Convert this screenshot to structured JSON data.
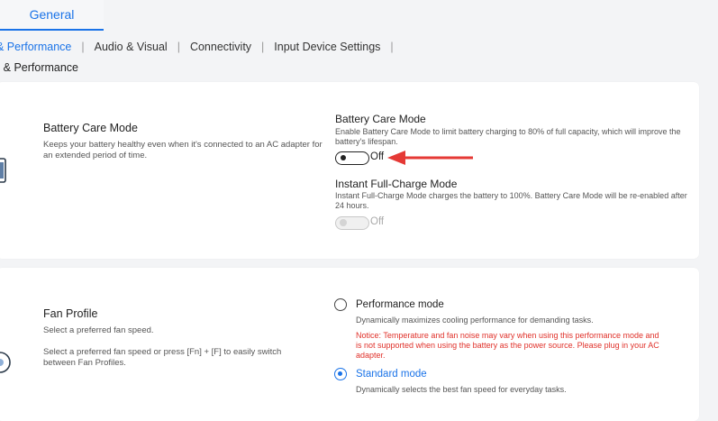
{
  "top_tab": {
    "label": "General"
  },
  "subnav": {
    "items": [
      "& Performance",
      "Audio & Visual",
      "Connectivity",
      "Input Device Settings"
    ],
    "separator": "|"
  },
  "section_title": "r & Performance",
  "battery_card": {
    "left_title": "Battery Care Mode",
    "left_desc": "Keeps your battery healthy even when it's connected to an AC adapter for an extended period of time.",
    "care_title": "Battery Care Mode",
    "care_desc": "Enable Battery Care Mode to limit battery charging to 80% of full capacity, which will improve the battery's lifespan.",
    "care_state": "Off",
    "instant_title": "Instant Full-Charge Mode",
    "instant_desc": "Instant Full-Charge Mode charges the battery to 100%. Battery Care Mode will be re-enabled after 24 hours.",
    "instant_state": "Off"
  },
  "fan_card": {
    "left_title": "Fan Profile",
    "left_desc1": "Select a preferred fan speed.",
    "left_desc2": "Select a preferred fan speed or press [Fn] + [F] to easily switch between Fan Profiles.",
    "perf_label": "Performance mode",
    "perf_desc": "Dynamically maximizes cooling performance for demanding tasks.",
    "notice": "Notice: Temperature and fan noise may vary when using this performance mode and is not supported when using the battery as the power source. Please plug in your AC adapter.",
    "standard_label": "Standard mode",
    "standard_desc": "Dynamically selects the best fan speed for everyday tasks."
  },
  "colors": {
    "accent": "#1a73e8",
    "notice": "#e0312a",
    "arrow": "#e53935"
  },
  "icons": [
    "battery-icon",
    "fan-icon",
    "arrow-annotation"
  ]
}
